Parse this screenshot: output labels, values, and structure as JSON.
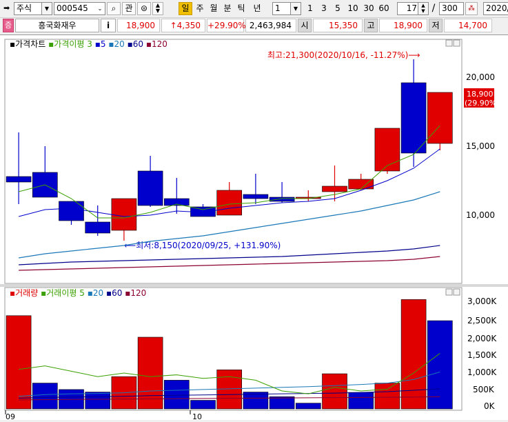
{
  "toolbar": {
    "market": "주식",
    "code": "000545",
    "btn_interest": "관",
    "periods": [
      "일",
      "주",
      "월",
      "분",
      "틱",
      "년"
    ],
    "period_active": "일",
    "count_value": "1",
    "count_presets": [
      "1",
      "3",
      "5",
      "10",
      "30",
      "60"
    ],
    "page_value": "17",
    "page_sep": "/",
    "page_total": "300",
    "date_value": "2020/"
  },
  "stock": {
    "badge": "증",
    "name": "흥국화재우",
    "info_btn": "i",
    "price": "18,900",
    "change": "↑4,350",
    "change_pct": "+29.90%",
    "volume": "2,463,984",
    "open_label": "시",
    "open": "15,350",
    "high_label": "고",
    "high": "18,900",
    "low_label": "저",
    "low": "14,700"
  },
  "price_panel": {
    "legend": {
      "title": "가격차트",
      "ma_title": "가격이평",
      "ma": [
        "3",
        "5",
        "20",
        "60",
        "120"
      ]
    },
    "y_ticks": [
      "20,000",
      "15,000",
      "10,000"
    ],
    "current_tag": "18,900",
    "current_pct": "(29.90%)",
    "max_label": "최고:21,300(2020/10/16, -11.27%)⟶",
    "min_label": "⟵최저:8,150(2020/09/25, +131.90%)"
  },
  "volume_panel": {
    "legend": {
      "title": "거래량",
      "ma_title": "거래이평",
      "ma": [
        "5",
        "20",
        "60",
        "120"
      ]
    },
    "y_ticks": [
      "3,000K",
      "2,500K",
      "2,000K",
      "1,500K",
      "1,000K",
      "500K",
      "0K"
    ]
  },
  "x_labels": [
    "09",
    "10"
  ],
  "colors": {
    "up": "#e00000",
    "down": "#0000cc",
    "ma3": "#3aa000",
    "ma5": "#0000cc",
    "ma20": "#1a78b8",
    "ma60": "#00008b",
    "ma120": "#8b0030"
  },
  "chart_data": [
    {
      "type": "candlestick",
      "y_range": [
        6000,
        22000
      ],
      "candles": [
        {
          "o": 12800,
          "h": 16000,
          "l": 10800,
          "c": 12400
        },
        {
          "o": 13100,
          "h": 15000,
          "l": 11400,
          "c": 11300
        },
        {
          "o": 11000,
          "h": 11000,
          "l": 9300,
          "c": 9600
        },
        {
          "o": 9500,
          "h": 10700,
          "l": 8500,
          "c": 8700
        },
        {
          "o": 8900,
          "h": 11200,
          "l": 8150,
          "c": 11200
        },
        {
          "o": 13200,
          "h": 14300,
          "l": 10600,
          "c": 10700
        },
        {
          "o": 11200,
          "h": 12700,
          "l": 10100,
          "c": 10700
        },
        {
          "o": 10600,
          "h": 10800,
          "l": 9900,
          "c": 9900
        },
        {
          "o": 10000,
          "h": 12400,
          "l": 10000,
          "c": 11800
        },
        {
          "o": 11500,
          "h": 13000,
          "l": 10800,
          "c": 11200
        },
        {
          "o": 11300,
          "h": 12400,
          "l": 10900,
          "c": 11000
        },
        {
          "o": 11300,
          "h": 11800,
          "l": 11000,
          "c": 11300
        },
        {
          "o": 11700,
          "h": 13600,
          "l": 11000,
          "c": 12100
        },
        {
          "o": 11900,
          "h": 13000,
          "l": 11800,
          "c": 12600
        },
        {
          "o": 13200,
          "h": 16300,
          "l": 13000,
          "c": 16300
        },
        {
          "o": 19600,
          "h": 21300,
          "l": 13500,
          "c": 14500
        },
        {
          "o": 15200,
          "h": 18900,
          "l": 14700,
          "c": 18900
        }
      ],
      "ma3": [
        11700,
        12200,
        11200,
        9800,
        9800,
        10200,
        10800,
        10400,
        10800,
        10900,
        11200,
        11200,
        11500,
        11900,
        13600,
        14400,
        16500
      ],
      "ma5": [
        9900,
        10400,
        10500,
        10200,
        9900,
        10000,
        10300,
        10200,
        10500,
        10700,
        10900,
        11000,
        11200,
        11800,
        12500,
        13400,
        14800
      ],
      "ma20": [
        6900,
        7200,
        7400,
        7600,
        7800,
        8100,
        8300,
        8500,
        8800,
        9100,
        9400,
        9700,
        10000,
        10300,
        10700,
        11100,
        11700
      ],
      "ma60": [
        6400,
        6500,
        6600,
        6650,
        6700,
        6750,
        6800,
        6850,
        6900,
        6950,
        7000,
        7100,
        7200,
        7300,
        7400,
        7550,
        7800
      ],
      "ma120": [
        6000,
        6050,
        6100,
        6150,
        6200,
        6250,
        6300,
        6350,
        6400,
        6450,
        6500,
        6550,
        6600,
        6650,
        6700,
        6800,
        7000
      ]
    },
    {
      "type": "bar",
      "y_range": [
        0,
        3200000
      ],
      "volume": [
        2600000,
        720000,
        540000,
        470000,
        900000,
        2000000,
        800000,
        240000,
        1090000,
        470000,
        340000,
        160000,
        980000,
        460000,
        720000,
        3050000,
        2460000
      ],
      "dir": [
        "up",
        "down",
        "down",
        "down",
        "up",
        "up",
        "down",
        "down",
        "up",
        "down",
        "down",
        "down",
        "up",
        "down",
        "up",
        "up",
        "down"
      ],
      "ma5": [
        1100000,
        1200000,
        1050000,
        900000,
        1000000,
        900000,
        950000,
        850000,
        900000,
        800000,
        500000,
        420000,
        600000,
        500000,
        550000,
        1000000,
        1550000
      ],
      "ma20": [
        350000,
        400000,
        420000,
        430000,
        450000,
        500000,
        520000,
        540000,
        560000,
        580000,
        600000,
        620000,
        650000,
        680000,
        720000,
        820000,
        1030000
      ],
      "ma60": [
        300000,
        320000,
        330000,
        340000,
        350000,
        370000,
        380000,
        390000,
        400000,
        410000,
        420000,
        430000,
        440000,
        460000,
        480000,
        520000,
        560000
      ],
      "ma120": [
        250000,
        260000,
        265000,
        270000,
        275000,
        280000,
        285000,
        290000,
        295000,
        300000,
        305000,
        310000,
        315000,
        320000,
        325000,
        330000,
        340000
      ]
    }
  ]
}
